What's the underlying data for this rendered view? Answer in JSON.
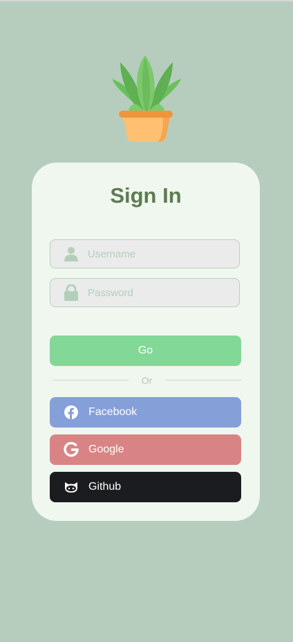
{
  "title": "Sign In",
  "username": {
    "placeholder": "Username",
    "value": ""
  },
  "password": {
    "placeholder": "Password",
    "value": ""
  },
  "go_label": "Go",
  "divider_text": "Or",
  "social": {
    "facebook": {
      "label": "Facebook",
      "icon": "facebook-icon"
    },
    "google": {
      "label": "Google",
      "icon": "google-icon"
    },
    "github": {
      "label": "Github",
      "icon": "github-icon"
    }
  },
  "colors": {
    "background": "#b6cdbd",
    "card": "#eff7ef",
    "title": "#5f7a51",
    "go": "#82d896",
    "facebook": "#859fd8",
    "google": "#d88484",
    "github": "#1b1c1f"
  },
  "logo_icon": "potted-plant-icon"
}
